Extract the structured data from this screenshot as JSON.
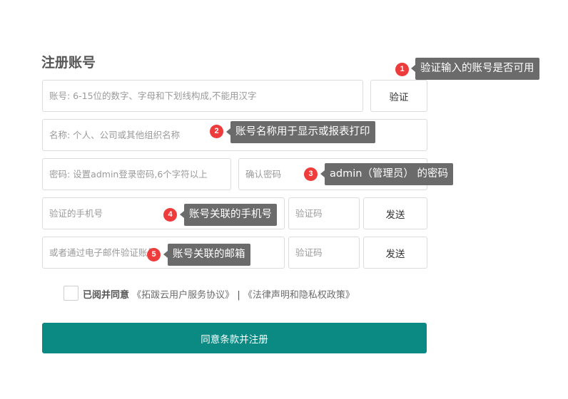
{
  "form": {
    "title": "注册账号",
    "account_placeholder": "账号: 6-15位的数字、字母和下划线构成,不能用汉字",
    "verify_button": "验证",
    "name_placeholder": "名称: 个人、公司或其他组织名称",
    "password_placeholder": "密码: 设置admin登录密码,6个字符以上",
    "confirm_password_placeholder": "确认密码",
    "phone_placeholder": "验证的手机号",
    "phone_code_placeholder": "验证码",
    "phone_send_button": "发送",
    "email_placeholder": "或者通过电子邮件验证账号",
    "email_code_placeholder": "验证码",
    "email_send_button": "发送",
    "agree_label": "已阅并同意",
    "terms_link": "《拓跋云用户服务协议》",
    "separator": "|",
    "privacy_link": "《法律声明和隐私权政策》",
    "submit_button": "同意条款并注册"
  },
  "tooltips": [
    {
      "number": "1",
      "text": "验证输入的账号是否可用"
    },
    {
      "number": "2",
      "text": "账号名称用于显示或报表打印"
    },
    {
      "number": "3",
      "text": "admin（管理员） 的密码"
    },
    {
      "number": "4",
      "text": "账号关联的手机号"
    },
    {
      "number": "5",
      "text": "账号关联的邮箱"
    }
  ],
  "colors": {
    "primary": "#0b8a84",
    "badge": "#ee3b3b",
    "tooltip": "#6b6b6b"
  }
}
